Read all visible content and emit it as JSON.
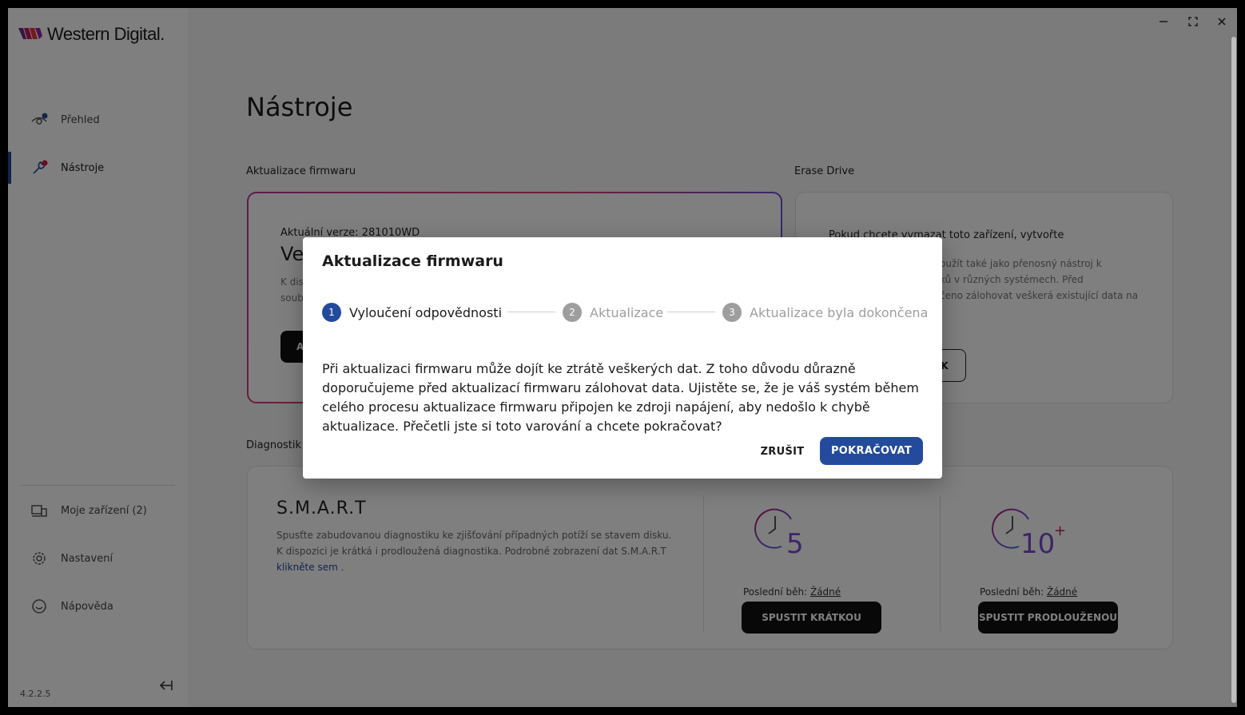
{
  "app": {
    "brand": "Western Digital.",
    "version": "4.2.2.5"
  },
  "sidebar": {
    "items": [
      {
        "label": "Přehled",
        "icon": "eye-icon",
        "active": false
      },
      {
        "label": "Nástroje",
        "icon": "wrench-icon",
        "active": true
      }
    ],
    "bottom_items": [
      {
        "label": "Moje zařízení (2)",
        "icon": "devices-icon"
      },
      {
        "label": "Nastavení",
        "icon": "gear-icon"
      },
      {
        "label": "Nápověda",
        "icon": "help-icon"
      }
    ]
  },
  "page": {
    "title": "Nástroje",
    "firmware_section": "Aktualizace firmwaru",
    "erase_section": "Erase Drive",
    "diagnostics_section": "Diagnostik",
    "firmware_card": {
      "current_version": "Aktuální verze: 281010WD",
      "heading_partial": "Ve",
      "desc_partial_1": "K dis",
      "desc_partial_2": "soub",
      "button_partial": "A"
    },
    "erase_card": {
      "heading": "Pokud chcete vymazat toto zařízení, vytvořte",
      "desc_line_1": "oužít také jako přenosný nástroj k",
      "desc_line_2": "ků v různých systémech. Před",
      "desc_line_3": "čeno zálohovat veškerá existující data na",
      "button_partial": "K"
    },
    "smart": {
      "title": "S.M.A.R.T",
      "desc": "Spusťte zabudovanou diagnostiku ke zjišťování případných potíží se stavem disku. K dispozici je krátká i prodloužená diagnostika. Podrobné zobrazení dat S.M.A.R.T",
      "link": "klikněte sem",
      "link_suffix": " .",
      "short": {
        "icon_number": "5",
        "last_run_label": "Poslední běh:",
        "last_run_value": "Žádné",
        "button": "SPUSTIT KRÁTKOU"
      },
      "long": {
        "icon_number": "10",
        "icon_suffix": "+",
        "last_run_label": "Poslední běh:",
        "last_run_value": "Žádné",
        "button": "SPUSTIT PRODLOUŽENOU"
      }
    }
  },
  "dialog": {
    "title": "Aktualizace firmwaru",
    "steps": [
      {
        "num": "1",
        "label": "Vyloučení odpovědnosti",
        "state": "active"
      },
      {
        "num": "2",
        "label": "Aktualizace",
        "state": "inactive"
      },
      {
        "num": "3",
        "label": "Aktualizace byla dokončena",
        "state": "inactive"
      }
    ],
    "body": "Při aktualizaci firmwaru může dojít ke ztrátě veškerých dat. Z toho důvodu důrazně doporučujeme před aktualizací firmwaru zálohovat data. Ujistěte se, že je váš systém během celého procesu aktualizace firmwaru připojen ke zdroji napájení, aby nedošlo k chybě aktualizace. Přečetli jste si toto varování a chcete pokračovat?",
    "cancel": "ZRUŠIT",
    "confirm": "POKRAČOVAT"
  },
  "colors": {
    "accent": "#234a9c",
    "dot_blue": "#234a9c",
    "dot_red": "#d81b3c"
  }
}
